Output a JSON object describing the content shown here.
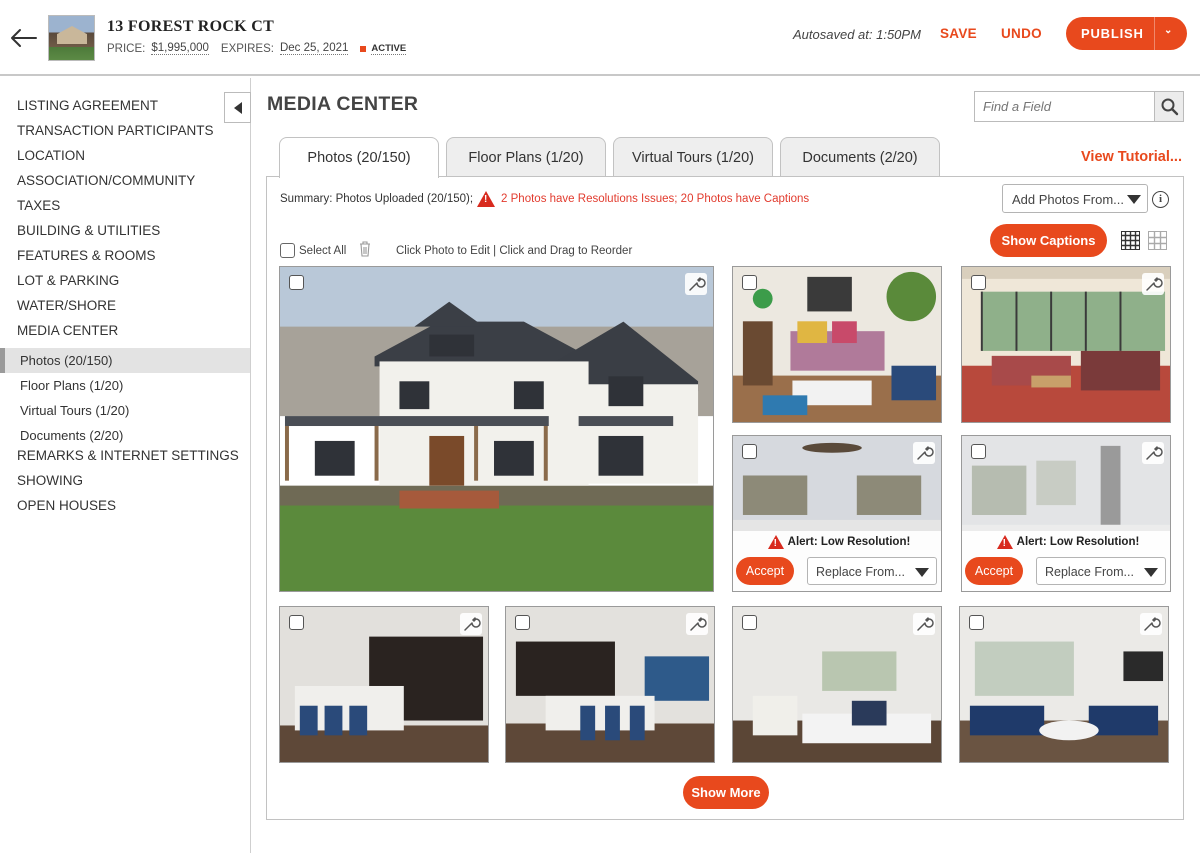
{
  "header": {
    "address": "13 FOREST ROCK CT",
    "price_label": "PRICE:",
    "price_value": "$1,995,000",
    "expires_label": "EXPIRES:",
    "expires_value": "Dec 25, 2021",
    "status": "ACTIVE",
    "autosave": "Autosaved at: 1:50PM",
    "save_label": "SAVE",
    "undo_label": "UNDO",
    "publish_label": "PUBLISH",
    "accent_color": "#e8491d"
  },
  "sidebar": {
    "items": [
      {
        "label": "LISTING AGREEMENT"
      },
      {
        "label": "TRANSACTION PARTICIPANTS"
      },
      {
        "label": "LOCATION"
      },
      {
        "label": "ASSOCIATION/COMMUNITY"
      },
      {
        "label": "TAXES"
      },
      {
        "label": "BUILDING & UTILITIES"
      },
      {
        "label": "FEATURES & ROOMS"
      },
      {
        "label": "LOT & PARKING"
      },
      {
        "label": "WATER/SHORE"
      },
      {
        "label": "MEDIA CENTER"
      }
    ],
    "sub_items": [
      {
        "label": "Photos (20/150)",
        "active": true
      },
      {
        "label": "Floor Plans (1/20)"
      },
      {
        "label": "Virtual Tours (1/20)"
      },
      {
        "label": "Documents (2/20)"
      }
    ],
    "bottom_items": [
      {
        "label": "REMARKS & INTERNET SETTINGS"
      },
      {
        "label": "SHOWING"
      },
      {
        "label": "OPEN HOUSES"
      }
    ]
  },
  "main": {
    "title": "MEDIA CENTER",
    "search_placeholder": "Find a Field",
    "tabs": [
      {
        "label": "Photos (20/150)",
        "active": true
      },
      {
        "label": "Floor Plans (1/20)"
      },
      {
        "label": "Virtual Tours (1/20)"
      },
      {
        "label": "Documents (2/20)"
      }
    ],
    "tutorial_link": "View Tutorial...",
    "summary_text": "Summary: Photos Uploaded (20/150);",
    "summary_warning": "2 Photos have Resolutions Issues; 20 Photos have Captions",
    "add_photos_label": "Add Photos From...",
    "select_all_label": "Select All",
    "hint_text": "Click Photo to Edit | Click and Drag to Reorder",
    "show_captions_label": "Show Captions",
    "alert_text": "Alert: Low Resolution!",
    "accept_label": "Accept",
    "replace_label": "Replace From...",
    "show_more_label": "Show More"
  }
}
